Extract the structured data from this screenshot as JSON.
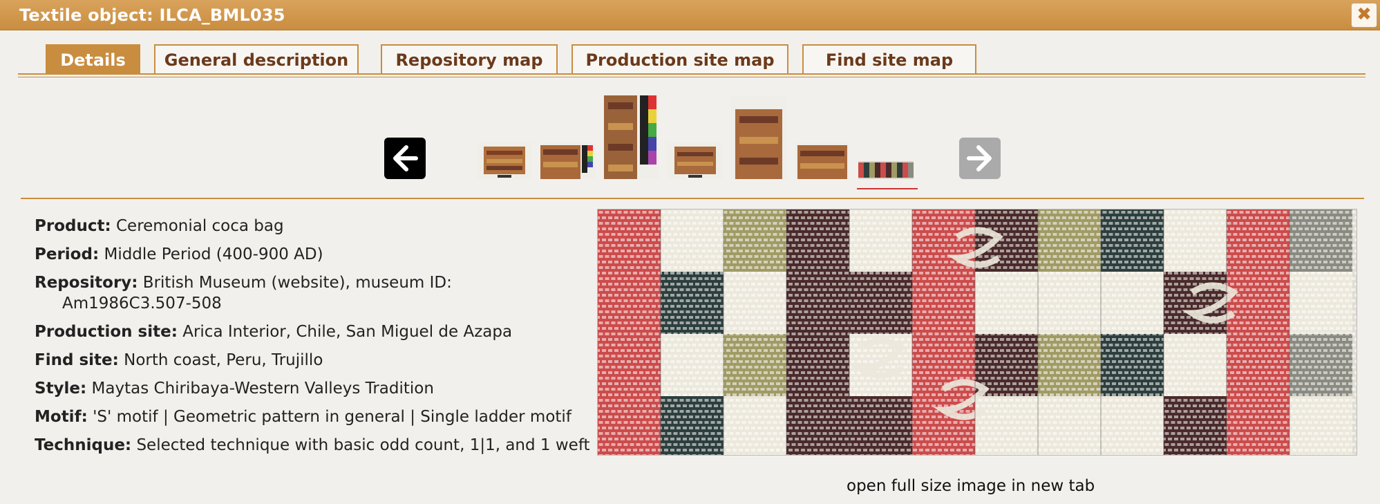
{
  "window": {
    "title": "Textile object: ILCA_BML035",
    "close_label": "✖"
  },
  "tabs": [
    {
      "label": "Details",
      "active": true
    },
    {
      "label": "General description",
      "active": false
    },
    {
      "label": "Repository map",
      "active": false
    },
    {
      "label": "Production site map",
      "active": false
    },
    {
      "label": "Find site map",
      "active": false
    }
  ],
  "gallery": {
    "prev_icon": "arrow-left-icon",
    "next_icon": "arrow-right-icon",
    "thumbnails_count": 7,
    "selected_index": 6
  },
  "details": {
    "product": {
      "key": "Product:",
      "value": "Ceremonial coca bag"
    },
    "period": {
      "key": "Period:",
      "value": "Middle Period (400-900 AD)"
    },
    "repository": {
      "key": "Repository:",
      "value": "British Museum (website), museum ID: Am1986C3.507-508"
    },
    "production_site": {
      "key": "Production site:",
      "value": "Arica Interior, Chile, San Miguel de Azapa"
    },
    "find_site": {
      "key": "Find site:",
      "value": "North coast, Peru, Trujillo"
    },
    "style": {
      "key": "Style:",
      "value": "Maytas Chiribaya-Western Valleys Tradition"
    },
    "motif": {
      "key": "Motif:",
      "value": "'S' motif | Geometric pattern in general | Single ladder motif"
    },
    "technique": {
      "key": "Technique:",
      "value": "Selected technique with basic odd count, 1|1, and 1 weft"
    }
  },
  "pattern": {
    "colors": {
      "red": "#cc4b4b",
      "dark_teal": "#2d3f3d",
      "olive": "#a09a64",
      "maroon": "#4a2a2a",
      "white": "#ece8dc",
      "grey": "#8a8a80"
    }
  },
  "open_full_size_label": "open full size image in new tab",
  "colors": {
    "accent": "#c98d3f",
    "tab_text": "#6b3a1c"
  }
}
